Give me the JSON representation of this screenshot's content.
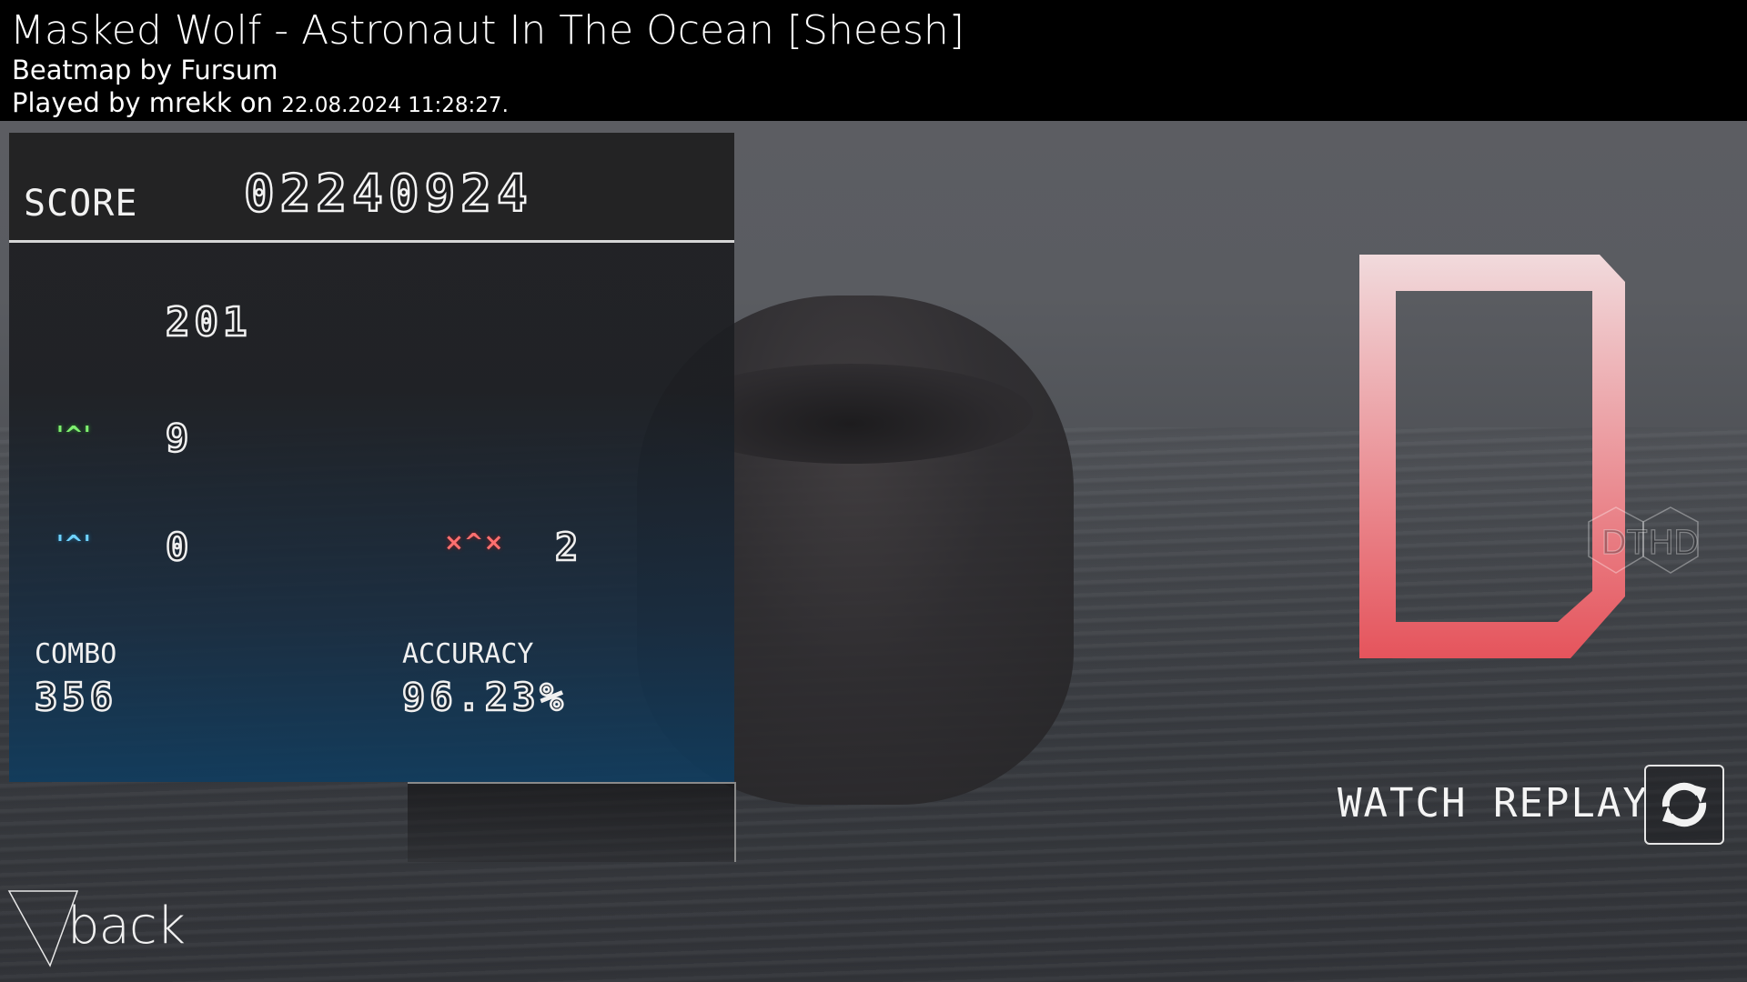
{
  "header": {
    "title": "Masked Wolf - Astronaut In The Ocean [Sheesh]",
    "beatmap_by": "Beatmap by Fursum",
    "played_by": "Played by mrekk on",
    "played_date": "22.08.2024 11:28:27."
  },
  "score": {
    "label": "SCORE",
    "value": "02240924"
  },
  "hits": {
    "great": "201",
    "good": "9",
    "meh": "0",
    "miss": "2",
    "good_icon": "'^'",
    "meh_icon": "'^'",
    "miss_icon": "×^×"
  },
  "combo": {
    "label": "COMBO",
    "value": "356"
  },
  "accuracy": {
    "label": "ACCURACY",
    "value": "96.23%"
  },
  "grade": "D",
  "mods": [
    "DT",
    "HD"
  ],
  "watch_replay": "WATCH REPLAY",
  "back": "back",
  "colors": {
    "grade_top": "#f0d6d8",
    "grade_bottom": "#e5525a",
    "hit_100": "#7ff070",
    "hit_50": "#6fd3ff",
    "hit_miss": "#ff6f6f"
  },
  "icons": {
    "replay": "replay-arrows-icon",
    "back": "back-triangle-icon"
  }
}
